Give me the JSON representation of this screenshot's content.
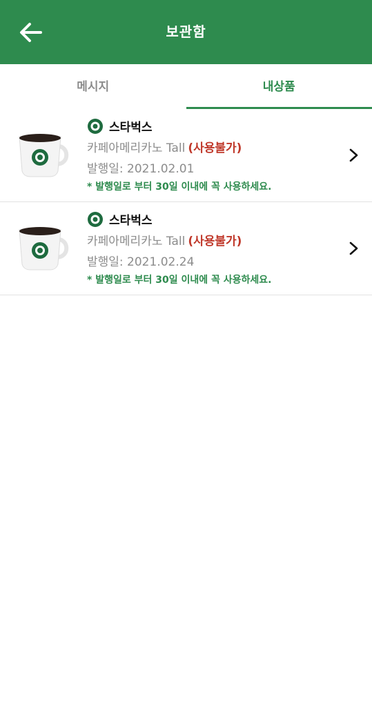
{
  "header": {
    "title": "보관함",
    "back_icon": "arrow-left-icon"
  },
  "tabs": [
    {
      "label": "메시지",
      "active": false
    },
    {
      "label": "내상품",
      "active": true
    }
  ],
  "items": [
    {
      "brand": "스타벅스",
      "product": "카페아메리카노 Tall",
      "status": "(사용불가)",
      "issue_date": "발행일: 2021.02.01",
      "note": "* 발행일로 부터 30일 이내에 꼭 사용하세요."
    },
    {
      "brand": "스타벅스",
      "product": "카페아메리카노 Tall",
      "status": "(사용불가)",
      "issue_date": "발행일: 2021.02.24",
      "note": "* 발행일로 부터 30일 이내에 꼭 사용하세요."
    }
  ],
  "colors": {
    "brand_green": "#2e8b4e",
    "status_red": "#c0392b",
    "muted_text": "#8c8c8c"
  }
}
